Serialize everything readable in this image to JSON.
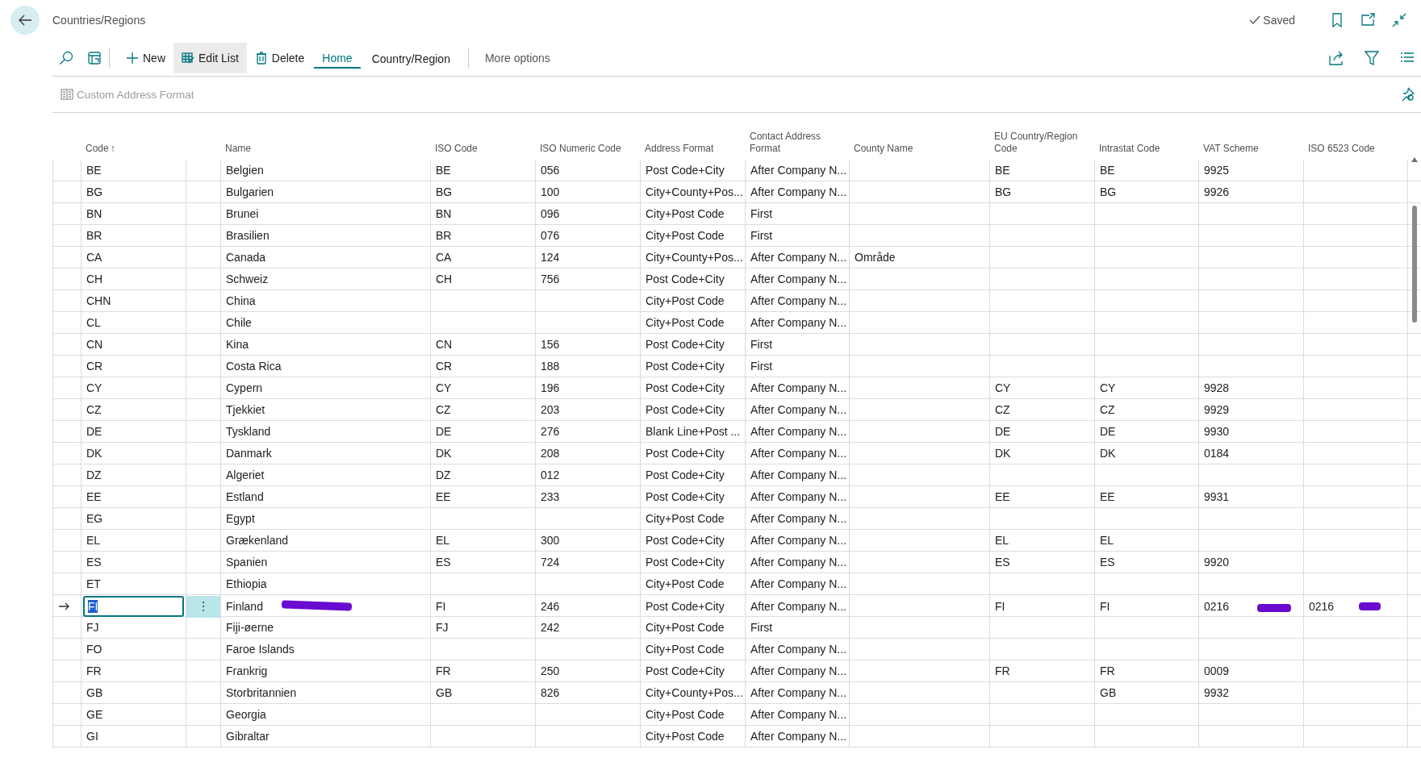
{
  "page": {
    "title": "Countries/Regions",
    "save_status": "Saved"
  },
  "actions": [
    {
      "kind": "new",
      "label": "New",
      "selected": false
    },
    {
      "kind": "edit",
      "label": "Edit List",
      "selected": true
    },
    {
      "kind": "delete",
      "label": "Delete",
      "selected": false
    }
  ],
  "tabs": [
    {
      "label": "Home",
      "selected": true
    },
    {
      "label": "Country/Region",
      "selected": false
    }
  ],
  "more_options": "More options",
  "sub_action": {
    "label": "Custom Address Format",
    "disabled": true
  },
  "table": {
    "columns": [
      {
        "label": "Code",
        "sort_arrow": "↑"
      },
      {
        "label": "Name"
      },
      {
        "label": "ISO Code"
      },
      {
        "label": "ISO Numeric Code"
      },
      {
        "label": "Address Format"
      },
      {
        "label": "Contact Address Format"
      },
      {
        "label": "County Name"
      },
      {
        "label": "EU Country/Region Code"
      },
      {
        "label": "Intrastat Code"
      },
      {
        "label": "VAT Scheme"
      },
      {
        "label": "ISO 6523 Code"
      }
    ],
    "rows": [
      {
        "selected": false,
        "cells": {
          "code": "BE",
          "name": "Belgien",
          "iso": "BE",
          "num": "056",
          "addr": "Post Code+City",
          "contact": "After Company N...",
          "eu": "BE",
          "intra": "BE",
          "vat": "9925"
        }
      },
      {
        "selected": false,
        "cells": {
          "code": "BG",
          "name": "Bulgarien",
          "iso": "BG",
          "num": "100",
          "addr": "City+County+Pos...",
          "contact": "After Company N...",
          "eu": "BG",
          "intra": "BG",
          "vat": "9926"
        }
      },
      {
        "selected": false,
        "cells": {
          "code": "BN",
          "name": "Brunei",
          "iso": "BN",
          "num": "096",
          "addr": "City+Post Code",
          "contact": "First"
        }
      },
      {
        "selected": false,
        "cells": {
          "code": "BR",
          "name": "Brasilien",
          "iso": "BR",
          "num": "076",
          "addr": "City+Post Code",
          "contact": "First"
        }
      },
      {
        "selected": false,
        "cells": {
          "code": "CA",
          "name": "Canada",
          "iso": "CA",
          "num": "124",
          "addr": "City+County+Pos...",
          "contact": "After Company N...",
          "county": "Område"
        }
      },
      {
        "selected": false,
        "cells": {
          "code": "CH",
          "name": "Schweiz",
          "iso": "CH",
          "num": "756",
          "addr": "Post Code+City",
          "contact": "After Company N..."
        }
      },
      {
        "selected": false,
        "cells": {
          "code": "CHN",
          "name": "China",
          "addr": "City+Post Code",
          "contact": "After Company N..."
        }
      },
      {
        "selected": false,
        "cells": {
          "code": "CL",
          "name": "Chile",
          "addr": "City+Post Code",
          "contact": "After Company N..."
        }
      },
      {
        "selected": false,
        "cells": {
          "code": "CN",
          "name": "Kina",
          "iso": "CN",
          "num": "156",
          "addr": "Post Code+City",
          "contact": "First"
        }
      },
      {
        "selected": false,
        "cells": {
          "code": "CR",
          "name": "Costa Rica",
          "iso": "CR",
          "num": "188",
          "addr": "Post Code+City",
          "contact": "First"
        }
      },
      {
        "selected": false,
        "cells": {
          "code": "CY",
          "name": "Cypern",
          "iso": "CY",
          "num": "196",
          "addr": "Post Code+City",
          "contact": "After Company N...",
          "eu": "CY",
          "intra": "CY",
          "vat": "9928"
        }
      },
      {
        "selected": false,
        "cells": {
          "code": "CZ",
          "name": "Tjekkiet",
          "iso": "CZ",
          "num": "203",
          "addr": "Post Code+City",
          "contact": "After Company N...",
          "eu": "CZ",
          "intra": "CZ",
          "vat": "9929"
        }
      },
      {
        "selected": false,
        "cells": {
          "code": "DE",
          "name": "Tyskland",
          "iso": "DE",
          "num": "276",
          "addr": "Blank Line+Post ...",
          "contact": "After Company N...",
          "eu": "DE",
          "intra": "DE",
          "vat": "9930"
        }
      },
      {
        "selected": false,
        "cells": {
          "code": "DK",
          "name": "Danmark",
          "iso": "DK",
          "num": "208",
          "addr": "Post Code+City",
          "contact": "After Company N...",
          "eu": "DK",
          "intra": "DK",
          "vat": "0184"
        }
      },
      {
        "selected": false,
        "cells": {
          "code": "DZ",
          "name": "Algeriet",
          "iso": "DZ",
          "num": "012",
          "addr": "Post Code+City",
          "contact": "After Company N..."
        }
      },
      {
        "selected": false,
        "cells": {
          "code": "EE",
          "name": "Estland",
          "iso": "EE",
          "num": "233",
          "addr": "Post Code+City",
          "contact": "After Company N...",
          "eu": "EE",
          "intra": "EE",
          "vat": "9931"
        }
      },
      {
        "selected": false,
        "cells": {
          "code": "EG",
          "name": "Egypt",
          "addr": "City+Post Code",
          "contact": "After Company N..."
        }
      },
      {
        "selected": false,
        "cells": {
          "code": "EL",
          "name": "Grækenland",
          "iso": "EL",
          "num": "300",
          "addr": "Post Code+City",
          "contact": "After Company N...",
          "eu": "EL",
          "intra": "EL"
        }
      },
      {
        "selected": false,
        "cells": {
          "code": "ES",
          "name": "Spanien",
          "iso": "ES",
          "num": "724",
          "addr": "Post Code+City",
          "contact": "After Company N...",
          "eu": "ES",
          "intra": "ES",
          "vat": "9920"
        }
      },
      {
        "selected": false,
        "cells": {
          "code": "ET",
          "name": "Ethiopia",
          "addr": "City+Post Code",
          "contact": "After Company N..."
        }
      },
      {
        "selected": true,
        "cells": {
          "code": "FI",
          "name": "Finland",
          "iso": "FI",
          "num": "246",
          "addr": "Post Code+City",
          "contact": "After Company N...",
          "eu": "FI",
          "intra": "FI",
          "vat": "0216",
          "iso6523": "0216"
        }
      },
      {
        "selected": false,
        "cells": {
          "code": "FJ",
          "name": "Fiji-øerne",
          "iso": "FJ",
          "num": "242",
          "addr": "City+Post Code",
          "contact": "First"
        }
      },
      {
        "selected": false,
        "cells": {
          "code": "FO",
          "name": "Faroe Islands",
          "addr": "City+Post Code",
          "contact": "After Company N..."
        }
      },
      {
        "selected": false,
        "cells": {
          "code": "FR",
          "name": "Frankrig",
          "iso": "FR",
          "num": "250",
          "addr": "Post Code+City",
          "contact": "After Company N...",
          "eu": "FR",
          "intra": "FR",
          "vat": "0009"
        }
      },
      {
        "selected": false,
        "cells": {
          "code": "GB",
          "name": "Storbritannien",
          "iso": "GB",
          "num": "826",
          "addr": "City+County+Pos...",
          "contact": "After Company N...",
          "intra": "GB",
          "vat": "9932"
        }
      },
      {
        "selected": false,
        "cells": {
          "code": "GE",
          "name": "Georgia",
          "addr": "City+Post Code",
          "contact": "After Company N..."
        }
      },
      {
        "selected": false,
        "cells": {
          "code": "GI",
          "name": "Gibraltar",
          "addr": "City+Post Code",
          "contact": "After Company N..."
        }
      }
    ]
  }
}
